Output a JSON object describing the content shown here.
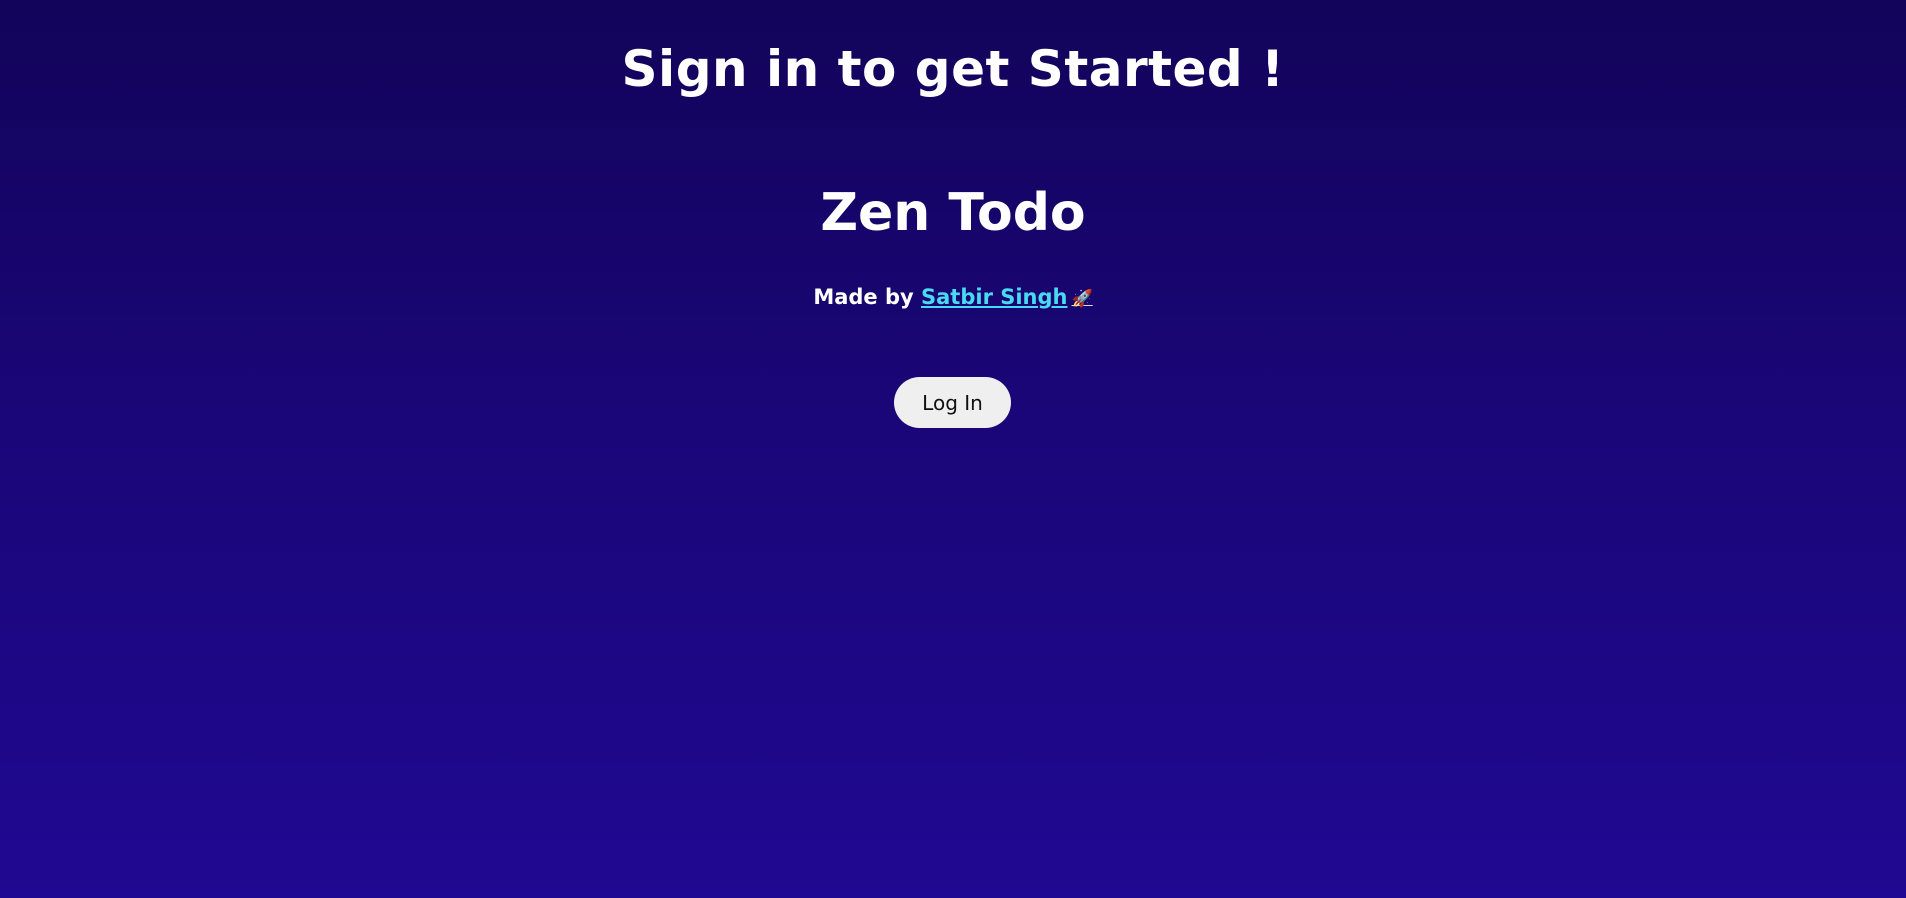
{
  "page": {
    "heading": "Sign in to get Started !",
    "app_title": "Zen Todo",
    "credit": {
      "prefix": "Made by",
      "author_link": "Satbir Singh",
      "icon": "rocket-icon",
      "icon_glyph": "🚀"
    },
    "login_button_label": "Log In"
  },
  "colors": {
    "background_top": "#12045a",
    "background_bottom": "#200892",
    "text": "#ffffff",
    "link": "#4ad9f2",
    "button_bg": "#efefef",
    "button_text": "#111111"
  }
}
